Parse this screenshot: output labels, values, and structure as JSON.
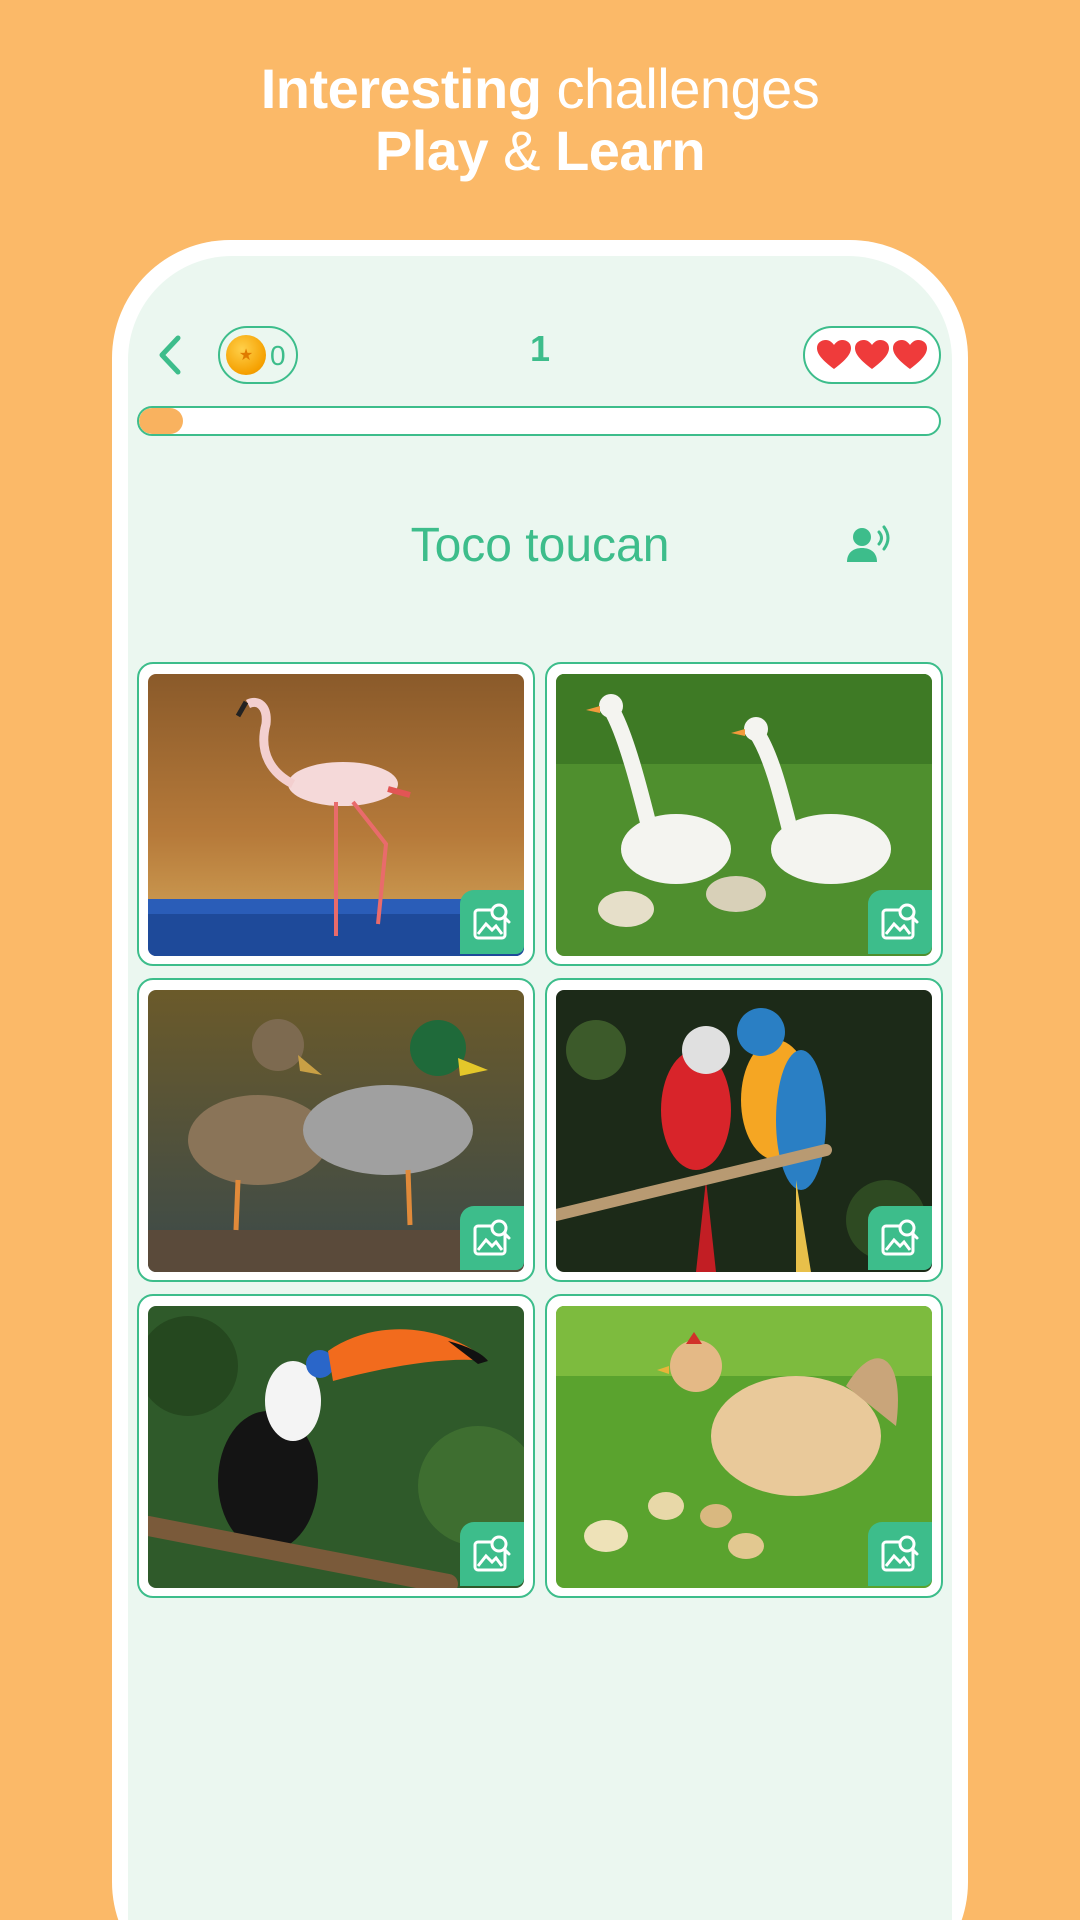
{
  "promo": {
    "line1_bold": "Interesting",
    "line1_light": " challenges",
    "line2_bold_a": "Play",
    "line2_light": " & ",
    "line2_bold_b": "Learn"
  },
  "topbar": {
    "back_icon": "chevron-left-icon",
    "coins": "0",
    "level": "1",
    "lives": 3
  },
  "progress": {
    "fraction": 0.055
  },
  "question": {
    "prompt": "Toco toucan",
    "speaker_icon": "speak-icon"
  },
  "options": [
    {
      "animal": "flamingo",
      "zoom_icon": "image-search-icon"
    },
    {
      "animal": "geese",
      "zoom_icon": "image-search-icon"
    },
    {
      "animal": "mallard-ducks",
      "zoom_icon": "image-search-icon"
    },
    {
      "animal": "macaws",
      "zoom_icon": "image-search-icon"
    },
    {
      "animal": "toucan",
      "zoom_icon": "image-search-icon"
    },
    {
      "animal": "hen-and-chicks",
      "zoom_icon": "image-search-icon"
    }
  ],
  "colors": {
    "background": "#fbb968",
    "accent": "#3dbd8b",
    "screen": "#ebf7f0",
    "heart": "#ef3b3b",
    "progress_fill": "#f9b25f"
  }
}
